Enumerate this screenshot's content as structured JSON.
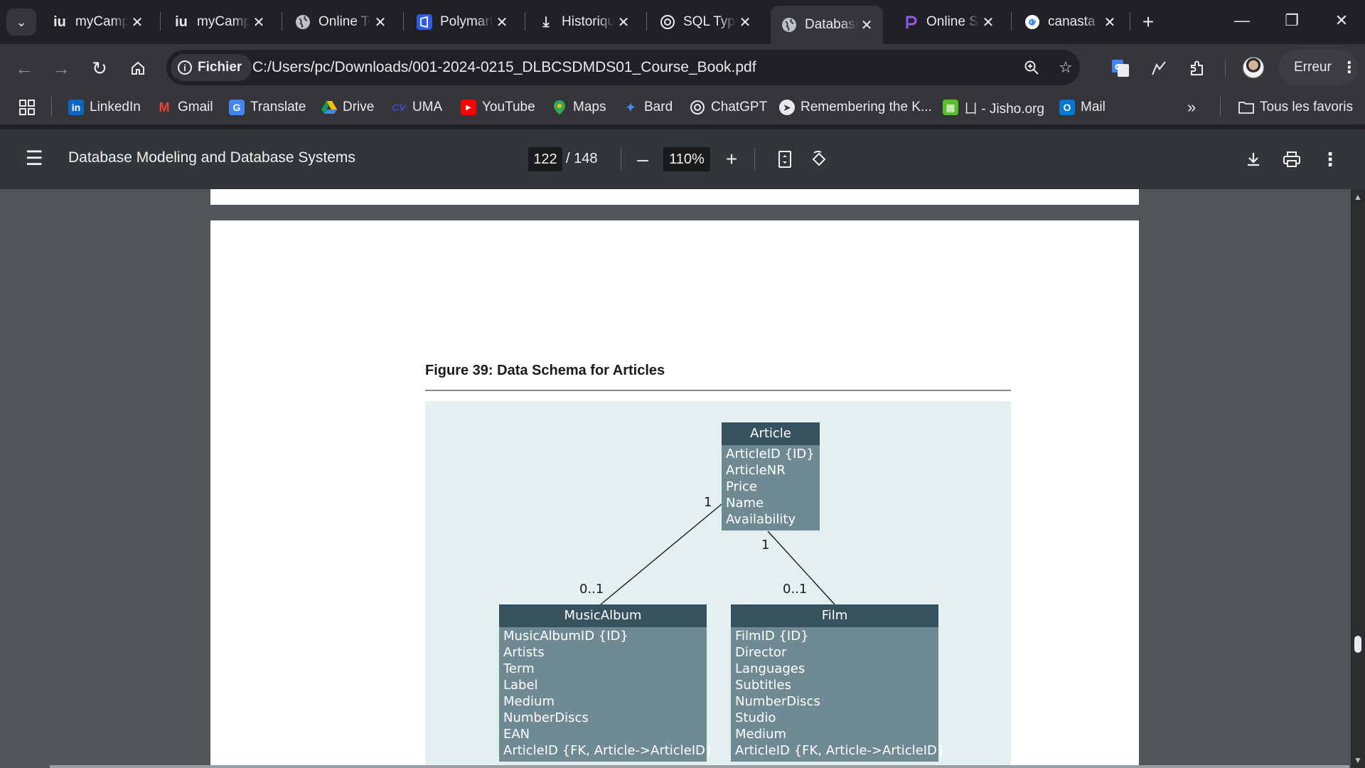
{
  "tabs": [
    {
      "title": "myCampus",
      "icon": "iu",
      "active": false
    },
    {
      "title": "myCampus",
      "icon": "iu",
      "active": false
    },
    {
      "title": "Online Tools",
      "icon": "globe",
      "active": false
    },
    {
      "title": "Polymarket",
      "icon": "polymarket",
      "active": false
    },
    {
      "title": "Historique",
      "icon": "download",
      "active": false
    },
    {
      "title": "SQL Types",
      "icon": "openai",
      "active": false
    },
    {
      "title": "Database",
      "icon": "globe",
      "active": true
    },
    {
      "title": "Online S",
      "icon": "p-gradient",
      "active": false
    },
    {
      "title": "canasta",
      "icon": "google",
      "active": false
    }
  ],
  "toolbar": {
    "site_chip": "Fichier",
    "url": "C:/Users/pc/Downloads/001-2024-0215_DLBCSDMDS01_Course_Book.pdf",
    "profile_status": "Erreur"
  },
  "bookmarks": [
    {
      "label": "LinkedIn",
      "icon": "linkedin-icon"
    },
    {
      "label": "Gmail",
      "icon": "gmail-icon"
    },
    {
      "label": "Translate",
      "icon": "translate-icon"
    },
    {
      "label": "Drive",
      "icon": "drive-icon"
    },
    {
      "label": "UMA",
      "icon": "uma-icon"
    },
    {
      "label": "YouTube",
      "icon": "youtube-icon"
    },
    {
      "label": "Maps",
      "icon": "maps-icon"
    },
    {
      "label": "Bard",
      "icon": "bard-icon"
    },
    {
      "label": "ChatGPT",
      "icon": "chatgpt-icon"
    },
    {
      "label": "Remembering the K...",
      "icon": "rtk-icon"
    },
    {
      "label": "ㄩ - Jisho.org",
      "icon": "jisho-icon"
    },
    {
      "label": "Mail",
      "icon": "outlook-icon"
    }
  ],
  "bookmarks_all": "Tous les favoris",
  "pdf": {
    "title": "Database Modeling and Database Systems",
    "page_current": "122",
    "page_total": "/ 148",
    "zoom": "110%"
  },
  "figure": {
    "caption": "Figure 39: Data Schema for Articles",
    "entities": {
      "article": {
        "name": "Article",
        "attrs": [
          "ArticleID {ID}",
          "ArticleNR",
          "Price",
          "Name",
          "Availability"
        ]
      },
      "music": {
        "name": "MusicAlbum",
        "attrs": [
          "MusicAlbumID {ID}",
          "Artists",
          "Term",
          "Label",
          "Medium",
          "NumberDiscs",
          "EAN",
          "ArticleID {FK, Article->ArticleID}"
        ]
      },
      "film": {
        "name": "Film",
        "attrs": [
          "FilmID {ID}",
          "Director",
          "Languages",
          "Subtitles",
          "NumberDiscs",
          "Studio",
          "Medium",
          "ArticleID {FK, Article->ArticleID}"
        ]
      }
    },
    "multiplicities": {
      "article_left": "1",
      "article_right": "1",
      "music": "0..1",
      "film": "0..1"
    }
  }
}
